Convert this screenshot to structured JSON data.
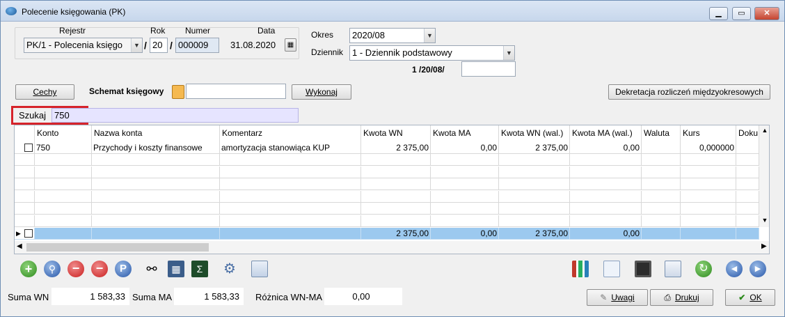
{
  "window": {
    "title": "Polecenie księgowania (PK)"
  },
  "header": {
    "rejestr_label": "Rejestr",
    "rejestr_value": "PK/1  - Polecenia księgo",
    "rok_label": "Rok",
    "rok_value": "20",
    "numer_label": "Numer",
    "numer_value": "000009",
    "data_label": "Data",
    "data_value": "31.08.2020",
    "slash1": "/",
    "slash2": "/",
    "okres_label": "Okres",
    "okres_value": "2020/08",
    "dziennik_label": "Dziennik",
    "dziennik_value": "1 - Dziennik podstawowy",
    "dziennik_number": "1 /20/08/",
    "dziennik_number_input": ""
  },
  "toolbar": {
    "cechy": "Cechy",
    "schemat_label": "Schemat księgowy",
    "schemat_value": "",
    "wykonaj": "Wykonaj",
    "dekretacja": "Dekretacja rozliczeń międzyokresowych"
  },
  "search": {
    "label": "Szukaj",
    "value": "750"
  },
  "grid": {
    "columns": [
      "Konto",
      "Nazwa konta",
      "Komentarz",
      "Kwota WN",
      "Kwota MA",
      "Kwota WN (wal.)",
      "Kwota MA (wal.)",
      "Waluta",
      "Kurs",
      "Doku"
    ],
    "rows": [
      {
        "konto": "750",
        "nazwa": "Przychody i koszty finansowe",
        "komentarz": "amortyzacja stanowiąca KUP",
        "kwota_wn": "2 375,00",
        "kwota_ma": "0,00",
        "kwota_wn_wal": "2 375,00",
        "kwota_ma_wal": "0,00",
        "waluta": "",
        "kurs": "0,000000",
        "doku": ""
      }
    ],
    "totals": {
      "kwota_wn": "2 375,00",
      "kwota_ma": "0,00",
      "kwota_wn_wal": "2 375,00",
      "kwota_ma_wal": "0,00"
    }
  },
  "icons": [
    "add-icon",
    "preview-icon",
    "delete-icon",
    "remove-filter-icon",
    "p-icon",
    "binoculars-icon",
    "calendar-grid-icon",
    "sigma-icon",
    "gears-icon",
    "window-chart-icon",
    "bar-chart-icon",
    "document-icon",
    "save-icon",
    "windows-icon",
    "refresh-icon",
    "prev-icon",
    "next-icon"
  ],
  "footer": {
    "suma_wn_label": "Suma WN",
    "suma_wn_value": "1 583,33",
    "suma_ma_label": "Suma MA",
    "suma_ma_value": "1 583,33",
    "roznica_label": "Różnica WN-MA",
    "roznica_value": "0,00",
    "uwagi": "Uwagi",
    "drukuj": "Drukuj",
    "ok": "OK"
  },
  "colors": {
    "highlight_red": "#d6232a",
    "selected_row": "#9cc9ef",
    "search_bg": "#e6e4ff"
  }
}
